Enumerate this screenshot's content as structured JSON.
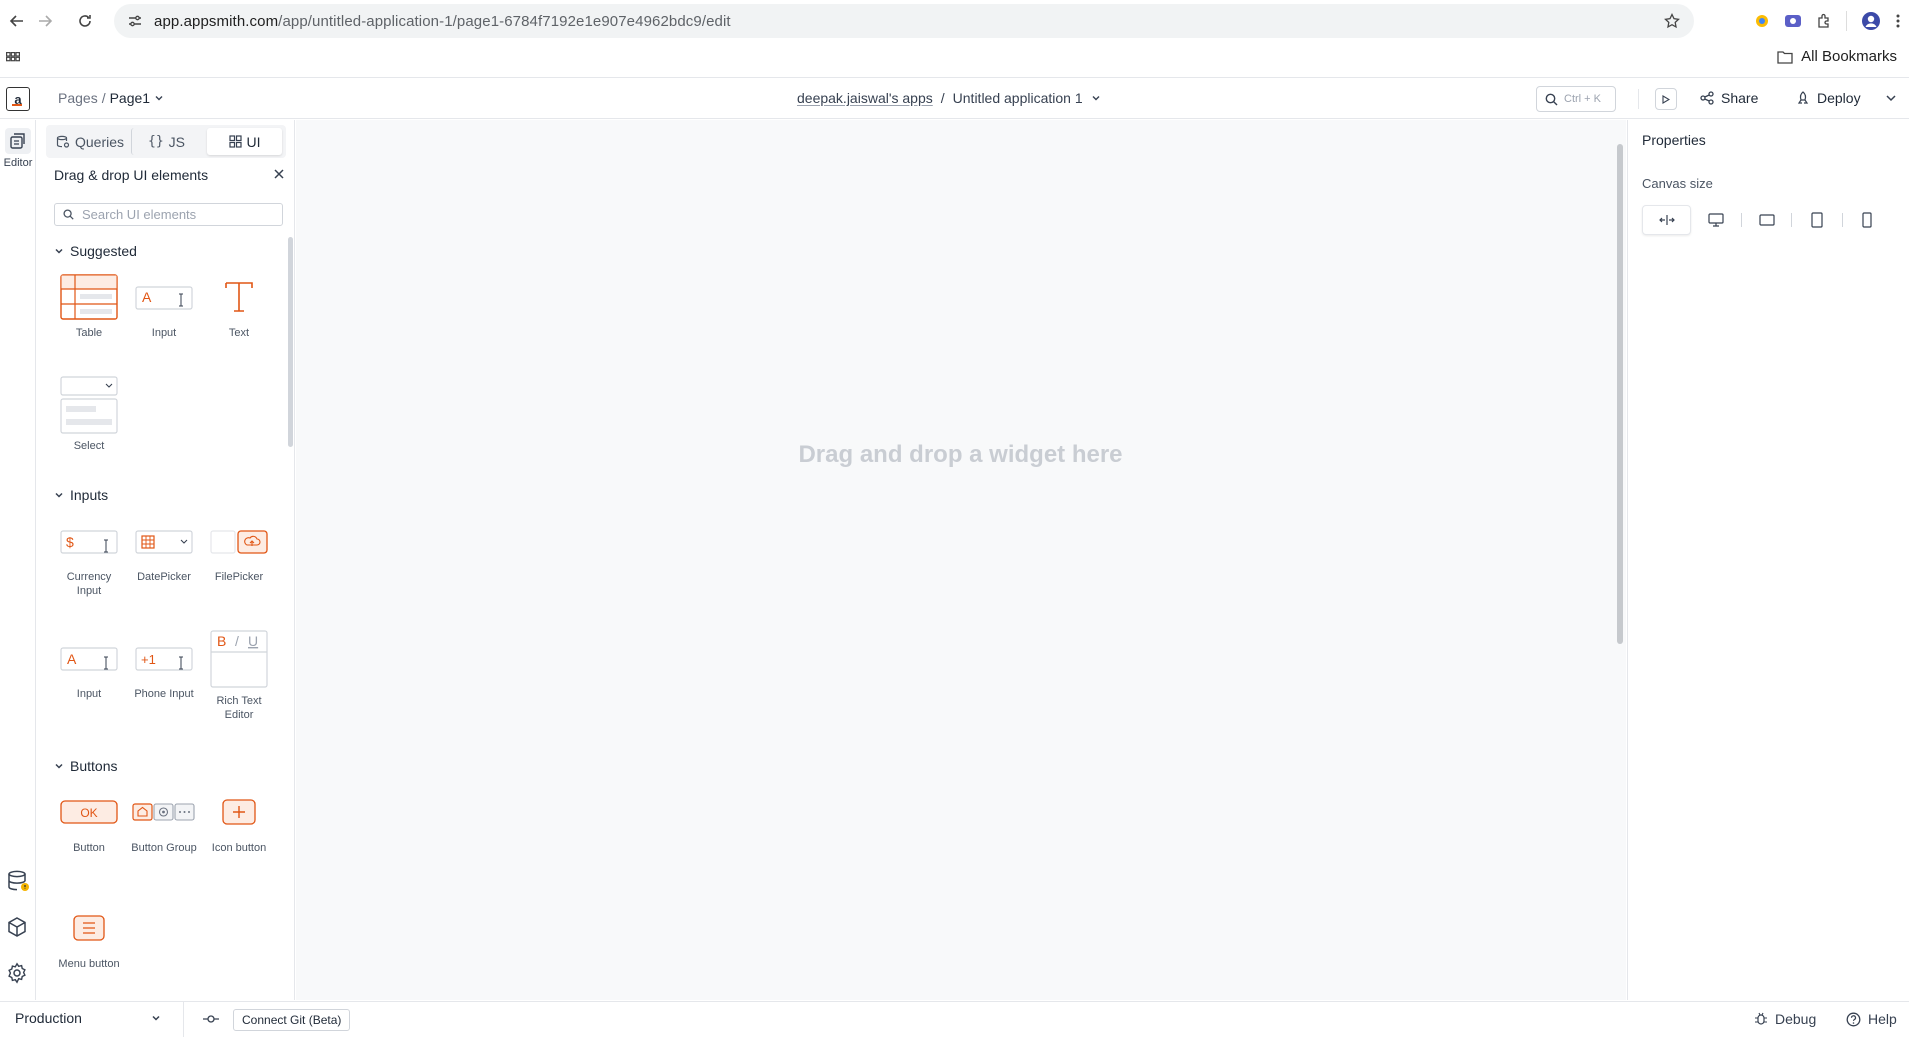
{
  "browser": {
    "url_domain": "app.appsmith.com",
    "url_path": "/app/untitled-application-1/page1-6784f7192e1e907e4962bdc9/edit",
    "bookmarks_label": "All Bookmarks"
  },
  "header": {
    "pages_label": "Pages",
    "separator": "/",
    "current_page": "Page1",
    "workspace": "deepak.jaiswal's apps",
    "app_name": "Untitled application 1",
    "search_shortcut": "Ctrl + K",
    "share_label": "Share",
    "deploy_label": "Deploy"
  },
  "rail": {
    "editor_label": "Editor"
  },
  "explorer": {
    "tabs": [
      {
        "label": "Queries",
        "icon": "queries-icon"
      },
      {
        "label": "JS",
        "icon": "braces-icon"
      },
      {
        "label": "UI",
        "icon": "widgets-icon"
      }
    ],
    "heading": "Drag & drop UI elements",
    "search_placeholder": "Search UI elements",
    "sections": {
      "suggested": "Suggested",
      "inputs": "Inputs",
      "buttons": "Buttons"
    },
    "widgets": {
      "table": "Table",
      "input": "Input",
      "text": "Text",
      "select": "Select",
      "currency_input": "Currency Input",
      "datepicker": "DatePicker",
      "filepicker": "FilePicker",
      "input2": "Input",
      "phone_input": "Phone Input",
      "rich_text_editor": "Rich Text Editor",
      "button": "Button",
      "button_group": "Button Group",
      "icon_button": "Icon button",
      "menu_button": "Menu button"
    },
    "thumb_text": {
      "input_a": "A",
      "text_t": "T",
      "currency": "$",
      "phone": "+1",
      "rte_b": "B",
      "rte_slash": "/",
      "rte_u": "U",
      "ok": "OK"
    }
  },
  "canvas": {
    "empty_text": "Drag and drop a widget here"
  },
  "properties": {
    "title": "Properties",
    "canvas_size_label": "Canvas size"
  },
  "bottom": {
    "environment": "Production",
    "git_button": "Connect Git (Beta)",
    "debug_label": "Debug",
    "help_label": "Help"
  },
  "colors": {
    "accent": "#e15615",
    "text": "#1f2937",
    "muted": "#6b7280"
  }
}
